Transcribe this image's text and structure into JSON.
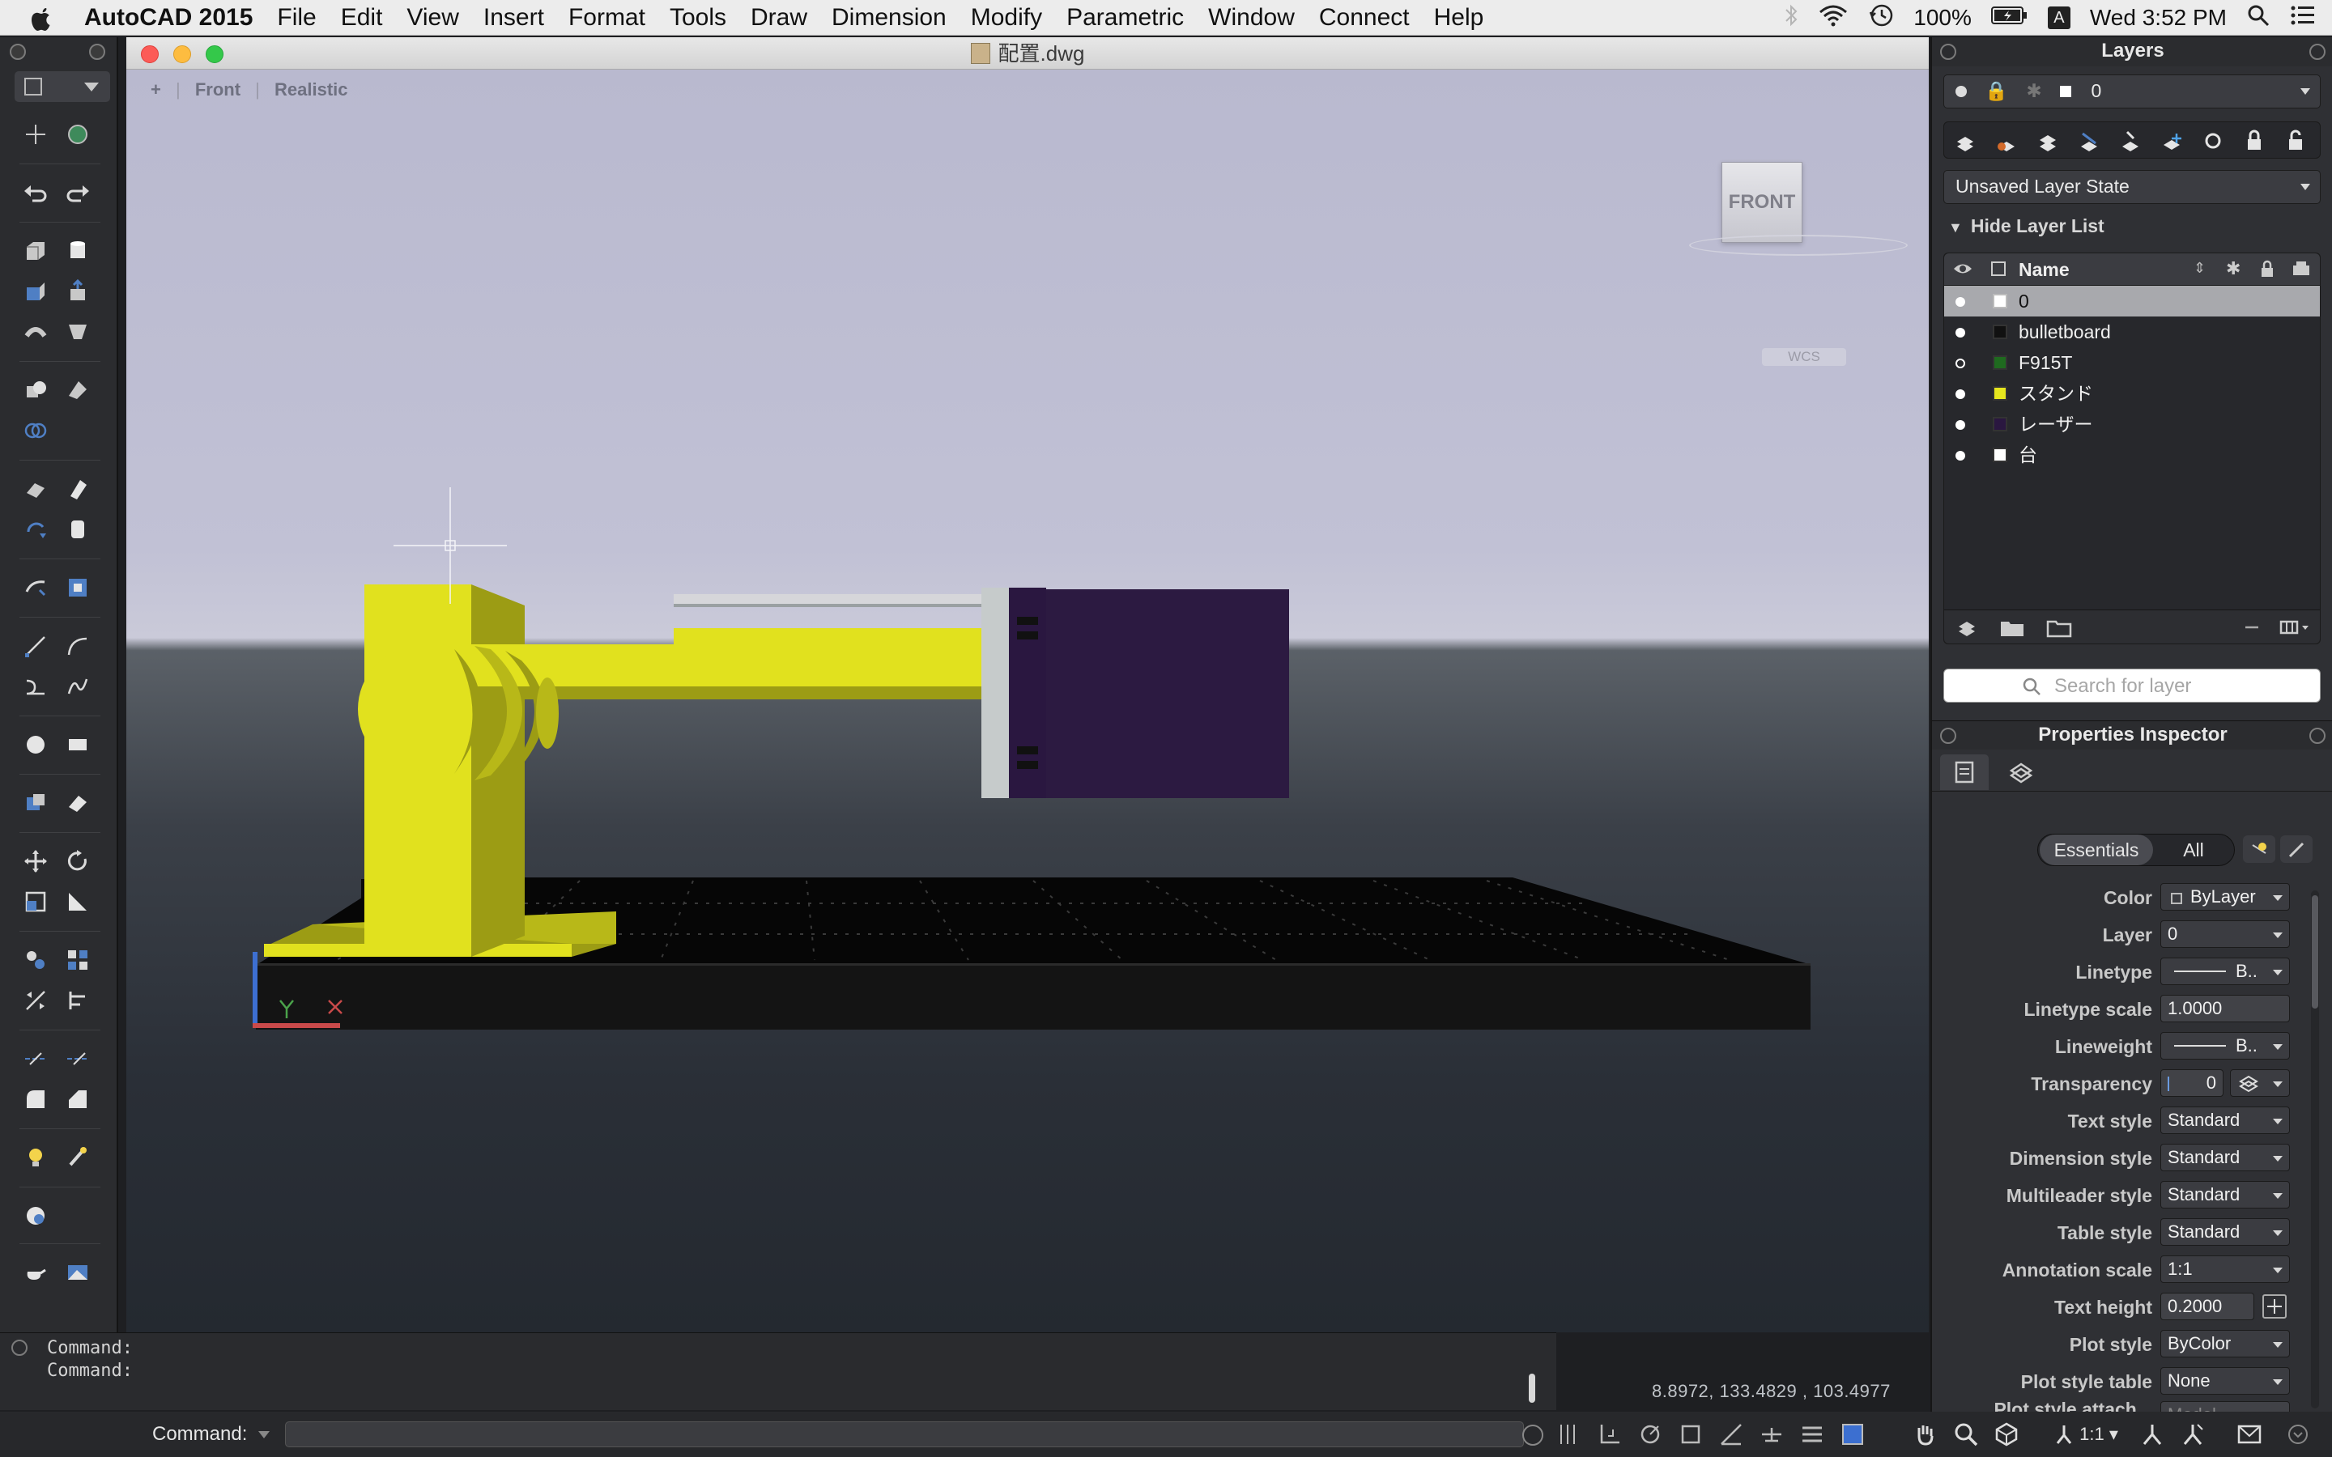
{
  "menubar": {
    "app": "AutoCAD 2015",
    "items": [
      "File",
      "Edit",
      "View",
      "Insert",
      "Format",
      "Tools",
      "Draw",
      "Dimension",
      "Modify",
      "Parametric",
      "Window",
      "Connect",
      "Help"
    ],
    "battery": "100%",
    "clock": "Wed 3:52 PM",
    "user_initial": "A"
  },
  "window": {
    "title": "配置.dwg"
  },
  "viewport": {
    "controls": [
      "+",
      "Front",
      "Realistic"
    ],
    "viewcube_label": "FRONT",
    "wcs_label": "WCS"
  },
  "command": {
    "history": [
      "Command:",
      "Command:"
    ],
    "prompt": "Command:"
  },
  "status": {
    "coordinates": "8.8972,   133.4829 , 103.4977",
    "annotation_scale": "1:1"
  },
  "layers_panel": {
    "title": "Layers",
    "current_layer": "0",
    "layer_state": "Unsaved Layer State",
    "hide_list_label": "Hide Layer List",
    "column_name": "Name",
    "search_placeholder": "Search for layer",
    "layers": [
      {
        "name": "0",
        "color": "#ffffff",
        "on": true
      },
      {
        "name": "bulletboard",
        "color": "#111111",
        "on": true
      },
      {
        "name": "F915T",
        "color": "#1f6a1f",
        "on": false
      },
      {
        "name": "スタンド",
        "color": "#e6e61e",
        "on": true
      },
      {
        "name": "レーザー",
        "color": "#2a1740",
        "on": true
      },
      {
        "name": "台",
        "color": "#ffffff",
        "on": true
      }
    ]
  },
  "properties_panel": {
    "title": "Properties Inspector",
    "tabs": [
      "Essentials",
      "All"
    ],
    "rows": [
      {
        "label": "Color",
        "value": "ByLayer",
        "kind": "select"
      },
      {
        "label": "Layer",
        "value": "0",
        "kind": "select"
      },
      {
        "label": "Linetype",
        "value": "B..",
        "kind": "select"
      },
      {
        "label": "Linetype scale",
        "value": "1.0000",
        "kind": "text"
      },
      {
        "label": "Lineweight",
        "value": "B..",
        "kind": "select"
      },
      {
        "label": "Transparency",
        "value": "0",
        "kind": "text"
      },
      {
        "label": "Text style",
        "value": "Standard",
        "kind": "select"
      },
      {
        "label": "Dimension style",
        "value": "Standard",
        "kind": "select"
      },
      {
        "label": "Multileader style",
        "value": "Standard",
        "kind": "select"
      },
      {
        "label": "Table style",
        "value": "Standard",
        "kind": "select"
      },
      {
        "label": "Annotation scale",
        "value": "1:1",
        "kind": "select"
      },
      {
        "label": "Text height",
        "value": "0.2000",
        "kind": "text"
      },
      {
        "label": "Plot style",
        "value": "ByColor",
        "kind": "select"
      },
      {
        "label": "Plot style table",
        "value": "None",
        "kind": "select"
      },
      {
        "label": "Plot style attach...",
        "value": "Model",
        "kind": "text"
      }
    ]
  },
  "colors": {
    "stand_yellow": "#e1e11e",
    "stand_shadow": "#9c9c14",
    "laser_purple": "#2c1a41",
    "board_black": "#0b0b0b",
    "panel_bg": "#2f3034"
  }
}
